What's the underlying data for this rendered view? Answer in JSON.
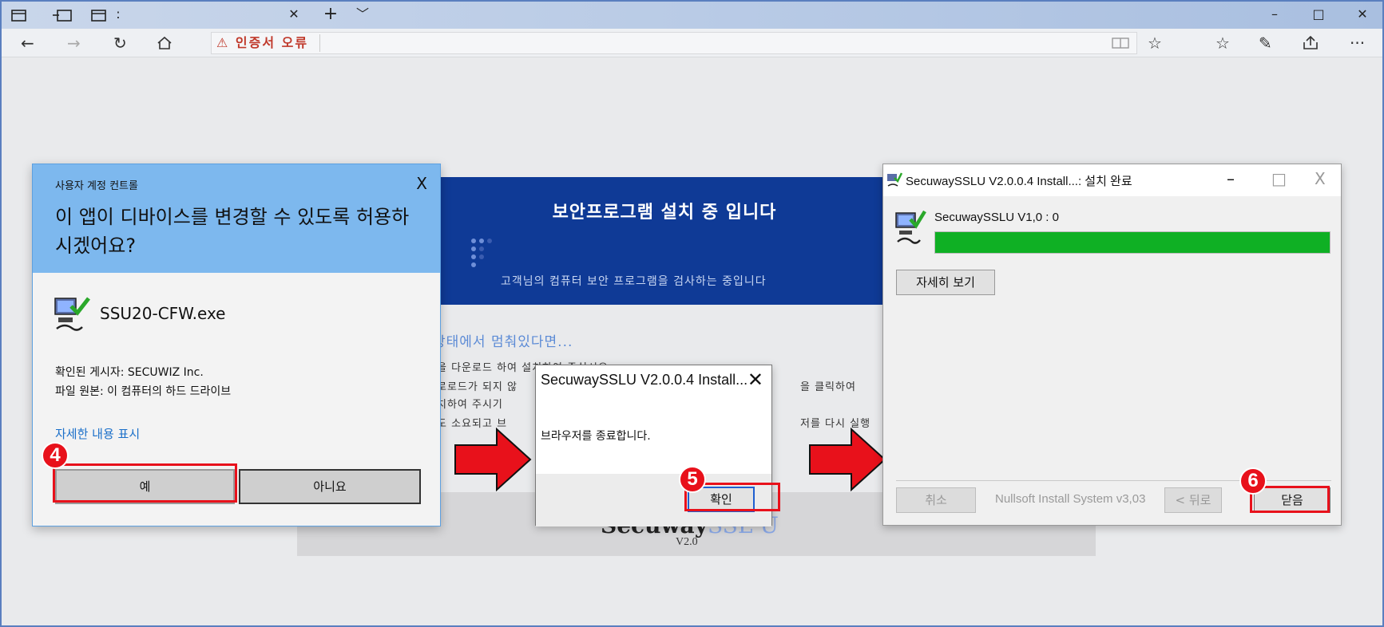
{
  "browser": {
    "tab_close_glyph": "✕",
    "new_tab_glyph": "+",
    "tab_menu_glyph": "﹀",
    "min_glyph": "–",
    "max_glyph": "□",
    "close_glyph": "✕",
    "cert_error_label": "⚠ 인증서 오류"
  },
  "page": {
    "banner_title": "보안프로그램 설치 중 입니다",
    "banner_subtitle": "고객님의 컴퓨터 보안 프로그램을 검사하는 중입니다",
    "stopped_heading": "상태에서 멈춰있다면...",
    "line1": "을 다운로드 하여 설치하여 주십시오",
    "line2": "로로드가 되지 않",
    "line2b": "을 클릭하여",
    "line3": "치하여 주시기",
    "line4": "도 소요되고 브",
    "line4b": "저를 다시 실행",
    "logo_prefix": "Secuway",
    "logo_suffix": "SSL U",
    "logo_version": "V2.0"
  },
  "uac": {
    "title_small": "사용자 계정 컨트롤",
    "close_glyph": "X",
    "question": "이 앱이 디바이스를 변경할 수 있도록 허용하시겠어요?",
    "app_name": "SSU20-CFW.exe",
    "publisher": "확인된 게시자: SECUWIZ Inc.",
    "origin": "파일 원본: 이 컴퓨터의 하드 드라이브",
    "more_link": "자세한 내용 표시",
    "yes_label": "예",
    "no_label": "아니요"
  },
  "confirm": {
    "title": "SecuwaySSLU V2.0.0.4 Install...",
    "close_glyph": "✕",
    "message": "브라우저를 종료합니다.",
    "ok_label": "확인"
  },
  "installer": {
    "title": "SecuwaySSLU V2.0.0.4 Install...: 설치 완료",
    "min_glyph": "–",
    "max_glyph": "□",
    "close_glyph": "X",
    "status": "SecuwaySSLU V1,0 : 0",
    "progress": 1.0,
    "details_label": "자세히 보기",
    "cancel_label": "취소",
    "footer_text": "Nullsoft Install System v3,03",
    "back_label": "< 뒤로",
    "close_label": "닫음"
  },
  "steps": [
    "4",
    "5",
    "6"
  ],
  "colors": {
    "highlight": "#e8111b",
    "progress_fill": "#0fb024",
    "banner": "#0f3a96",
    "uac_header": "#7db8ee"
  }
}
